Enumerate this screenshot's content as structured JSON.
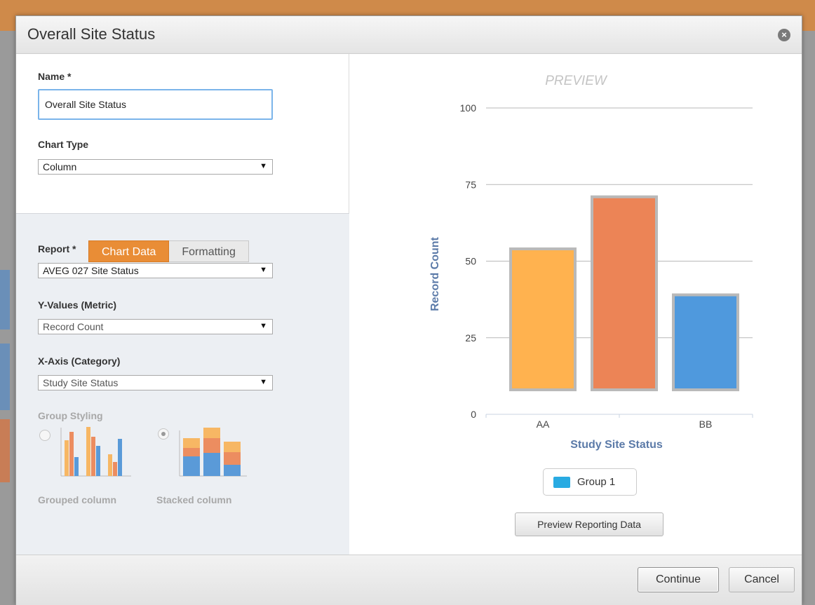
{
  "window": {
    "title": "Overall Site Status"
  },
  "form": {
    "name_label": "Name *",
    "name_value": "Overall Site Status",
    "chart_type_label": "Chart Type",
    "chart_type_value": "Column",
    "tabs": [
      {
        "label": "Chart Data",
        "active": true
      },
      {
        "label": "Formatting",
        "active": false
      }
    ],
    "report_label": "Report *",
    "report_value": "AVEG 027 Site Status",
    "yvalues_label": "Y-Values (Metric)",
    "yvalues_value": "Record Count",
    "xaxis_label": "X-Axis (Category)",
    "xaxis_value": "Study Site Status",
    "group_styling_label": "Group Styling",
    "group_styles": [
      {
        "label": "Grouped column",
        "selected": false
      },
      {
        "label": "Stacked column",
        "selected": true
      }
    ],
    "dropdown_arrow": "▼"
  },
  "preview": {
    "heading": "PREVIEW",
    "legend_label": "Group 1",
    "preview_button": "Preview Reporting Data"
  },
  "footer": {
    "continue_label": "Continue",
    "cancel_label": "Cancel"
  },
  "colors": {
    "accent": "#e98d36",
    "bar1": "#ffb24f",
    "bar2": "#ec8456",
    "bar3": "#4f99dd",
    "legend": "#29abe2",
    "axis_title": "#5b7aa8"
  },
  "chart_data": {
    "type": "bar",
    "categories": [
      "AA",
      "",
      "BB"
    ],
    "tick_labels": [
      "AA",
      "BB"
    ],
    "values": [
      54,
      71,
      39
    ],
    "baseline": 8,
    "series": [
      {
        "name": "Group 1",
        "values": [
          54,
          71,
          39
        ]
      }
    ],
    "xlabel": "Study Site Status",
    "ylabel": "Record Count",
    "ylim": [
      0,
      100
    ],
    "yticks": [
      0,
      25,
      50,
      75,
      100
    ],
    "grid": true
  }
}
